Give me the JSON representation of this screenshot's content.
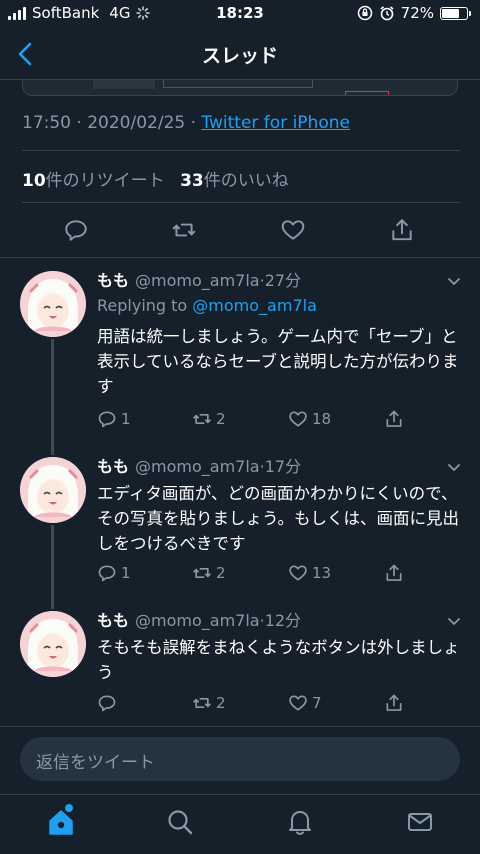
{
  "status_bar": {
    "carrier": "SoftBank",
    "network": "4G",
    "time": "18:23",
    "battery": "72%",
    "battery_level": 0.72
  },
  "nav": {
    "title": "スレッド",
    "back_icon": "chevron-left-icon"
  },
  "tweet": {
    "time": "17:50",
    "date": "2020/02/25",
    "separator": "·",
    "source": "Twitter for iPhone",
    "retweets": "10",
    "retweets_label": "件のリツイート",
    "likes": "33",
    "likes_label": "件のいいね"
  },
  "replies": [
    {
      "name": "もも",
      "handle": "@momo_am7la",
      "dot": "·",
      "time": "27分",
      "replying_prefix": "Replying to ",
      "replying_to": "@momo_am7la",
      "text": "用語は統一しましょう。ゲーム内で「セーブ」と表示しているならセーブと説明した方が伝わります",
      "reply_count": "1",
      "retweet_count": "2",
      "like_count": "18"
    },
    {
      "name": "もも",
      "handle": "@momo_am7la",
      "dot": "·",
      "time": "17分",
      "text": "エディタ画面が、どの画面かわかりにくいので、その写真を貼りましょう。もしくは、画面に見出しをつけるべきです",
      "reply_count": "1",
      "retweet_count": "2",
      "like_count": "13"
    },
    {
      "name": "もも",
      "handle": "@momo_am7la",
      "dot": "·",
      "time": "12分",
      "text": "そもそも誤解をまねくようなボタンは外しましょう",
      "reply_count": "",
      "retweet_count": "2",
      "like_count": "7"
    }
  ],
  "composer": {
    "placeholder": "返信をツイート"
  },
  "colors": {
    "background": "#15202b",
    "accent": "#1da1f2",
    "muted": "#8899a6",
    "border": "#38444d"
  }
}
